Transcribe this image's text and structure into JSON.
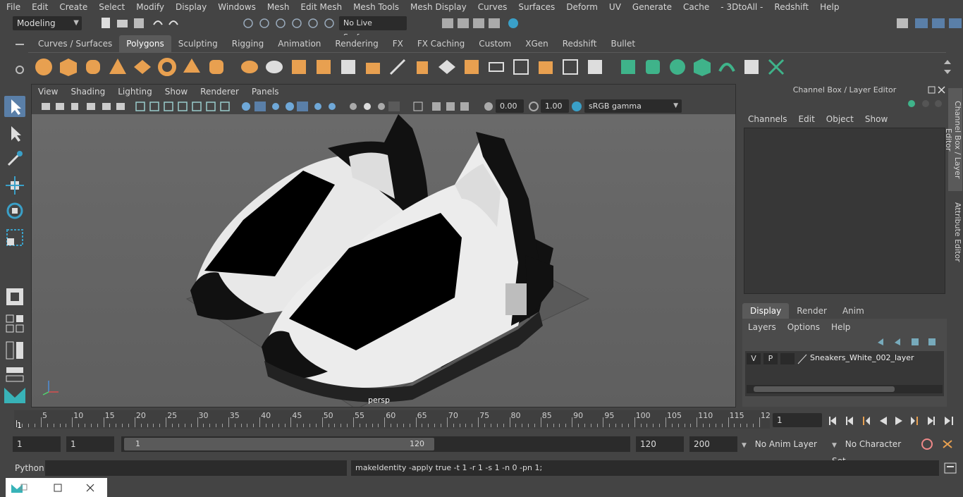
{
  "menubar": {
    "items": [
      "File",
      "Edit",
      "Create",
      "Select",
      "Modify",
      "Display",
      "Windows",
      "Mesh",
      "Edit Mesh",
      "Mesh Tools",
      "Mesh Display",
      "Curves",
      "Surfaces",
      "Deform",
      "UV",
      "Generate",
      "Cache",
      "- 3DtoAll -",
      "Redshift",
      "Help"
    ]
  },
  "status": {
    "workspace": "Modeling",
    "live_surface": "No Live Surface"
  },
  "shelf": {
    "tabs": [
      "Curves / Surfaces",
      "Polygons",
      "Sculpting",
      "Rigging",
      "Animation",
      "Rendering",
      "FX",
      "FX Caching",
      "Custom",
      "XGen",
      "Redshift",
      "Bullet"
    ],
    "active_tab": "Polygons"
  },
  "viewport": {
    "menu": [
      "View",
      "Shading",
      "Lighting",
      "Show",
      "Renderer",
      "Panels"
    ],
    "exposure": "0.00",
    "gamma": "1.00",
    "color_space": "sRGB gamma",
    "camera_label": "persp"
  },
  "channel_box": {
    "title": "Channel Box / Layer Editor",
    "menu": [
      "Channels",
      "Edit",
      "Object",
      "Show"
    ],
    "layer_tabs": [
      "Display",
      "Render",
      "Anim"
    ],
    "active_layer_tab": "Display",
    "layer_menu": [
      "Layers",
      "Options",
      "Help"
    ],
    "layer": {
      "v": "V",
      "p": "P",
      "name": "Sneakers_White_002_layer"
    }
  },
  "side_tabs": [
    "Channel Box / Layer Editor",
    "Attribute Editor"
  ],
  "time_slider": {
    "labels": [
      "5",
      "10",
      "15",
      "20",
      "25",
      "30",
      "35",
      "40",
      "45",
      "50",
      "55",
      "60",
      "65",
      "70",
      "75",
      "80",
      "85",
      "90",
      "95",
      "100",
      "105",
      "110",
      "115",
      "12"
    ],
    "current_marker": "1",
    "current_frame": "1"
  },
  "range": {
    "start": "1",
    "playback_start": "1",
    "slider_start": "1",
    "slider_end": "120",
    "playback_end": "120",
    "end": "200",
    "anim_layer": "No Anim Layer",
    "character_set": "No Character Set"
  },
  "command": {
    "language": "Python",
    "result": "makeIdentity -apply true -t 1 -r 1 -s 1 -n 0 -pn 1;"
  },
  "colors": {
    "accent_orange": "#e8a050",
    "accent_green": "#3fb38a",
    "selected_blue": "#5a7fa8"
  }
}
